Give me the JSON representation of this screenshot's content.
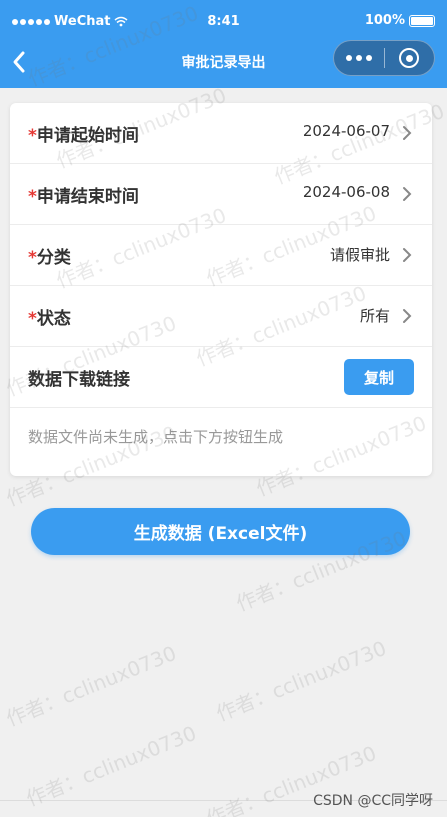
{
  "status_bar": {
    "carrier": "WeChat",
    "time": "8:41",
    "battery": "100%"
  },
  "nav": {
    "title": "审批记录导出"
  },
  "form": {
    "start": {
      "required_mark": "*",
      "label": "申请起始时间",
      "value": "2024-06-07"
    },
    "end": {
      "required_mark": "*",
      "label": "申请结束时间",
      "value": "2024-06-08"
    },
    "category": {
      "required_mark": "*",
      "label": "分类",
      "value": "请假审批"
    },
    "status": {
      "required_mark": "*",
      "label": "状态",
      "value": "所有"
    },
    "download": {
      "label": "数据下载链接",
      "copy_label": "复制"
    },
    "hint": "数据文件尚未生成，点击下方按钮生成"
  },
  "generate_button": "生成数据 (Excel文件)",
  "watermark": "作者：cclinux0730",
  "footer_credit": "CSDN @CC同学呀",
  "colors": {
    "primary": "#3a9cf0",
    "required": "#e53935"
  }
}
